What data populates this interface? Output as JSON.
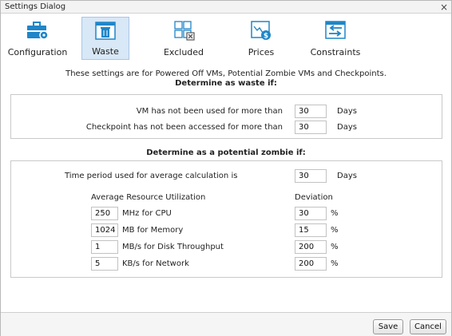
{
  "window": {
    "title": "Settings Dialog",
    "close_glyph": "×"
  },
  "tabs": [
    {
      "label": "Configuration",
      "icon": "briefcase-gear-icon",
      "selected": false
    },
    {
      "label": "Waste",
      "icon": "window-trash-icon",
      "selected": true
    },
    {
      "label": "Excluded",
      "icon": "grid-excluded-icon",
      "selected": false
    },
    {
      "label": "Prices",
      "icon": "chart-dollar-icon",
      "selected": false
    },
    {
      "label": "Constraints",
      "icon": "window-arrow-icon",
      "selected": false
    }
  ],
  "intro": "These settings are for Powered Off VMs, Potential Zombie VMs and Checkpoints.",
  "waste": {
    "title": "Determine as waste if:",
    "vm_label": "VM has not been used for more than",
    "vm_value": "30",
    "vm_unit": "Days",
    "checkpoint_label": "Checkpoint has not been accessed for more than",
    "checkpoint_value": "30",
    "checkpoint_unit": "Days"
  },
  "zombie": {
    "title": "Determine as a potential zombie if:",
    "period_label": "Time period used for average calculation is",
    "period_value": "30",
    "period_unit": "Days",
    "util_header": "Average Resource Utilization",
    "deviation_header": "Deviation",
    "rows": [
      {
        "value": "250",
        "label": "MHz for CPU",
        "deviation": "30",
        "unit": "%"
      },
      {
        "value": "1024",
        "label": "MB for Memory",
        "deviation": "15",
        "unit": "%"
      },
      {
        "value": "1",
        "label": "MB/s for Disk Throughput",
        "deviation": "200",
        "unit": "%"
      },
      {
        "value": "5",
        "label": "KB/s for Network",
        "deviation": "200",
        "unit": "%"
      }
    ]
  },
  "buttons": {
    "save": "Save",
    "cancel": "Cancel"
  },
  "colors": {
    "accent": "#1f86c8",
    "selected_bg": "#d8e8f7"
  }
}
